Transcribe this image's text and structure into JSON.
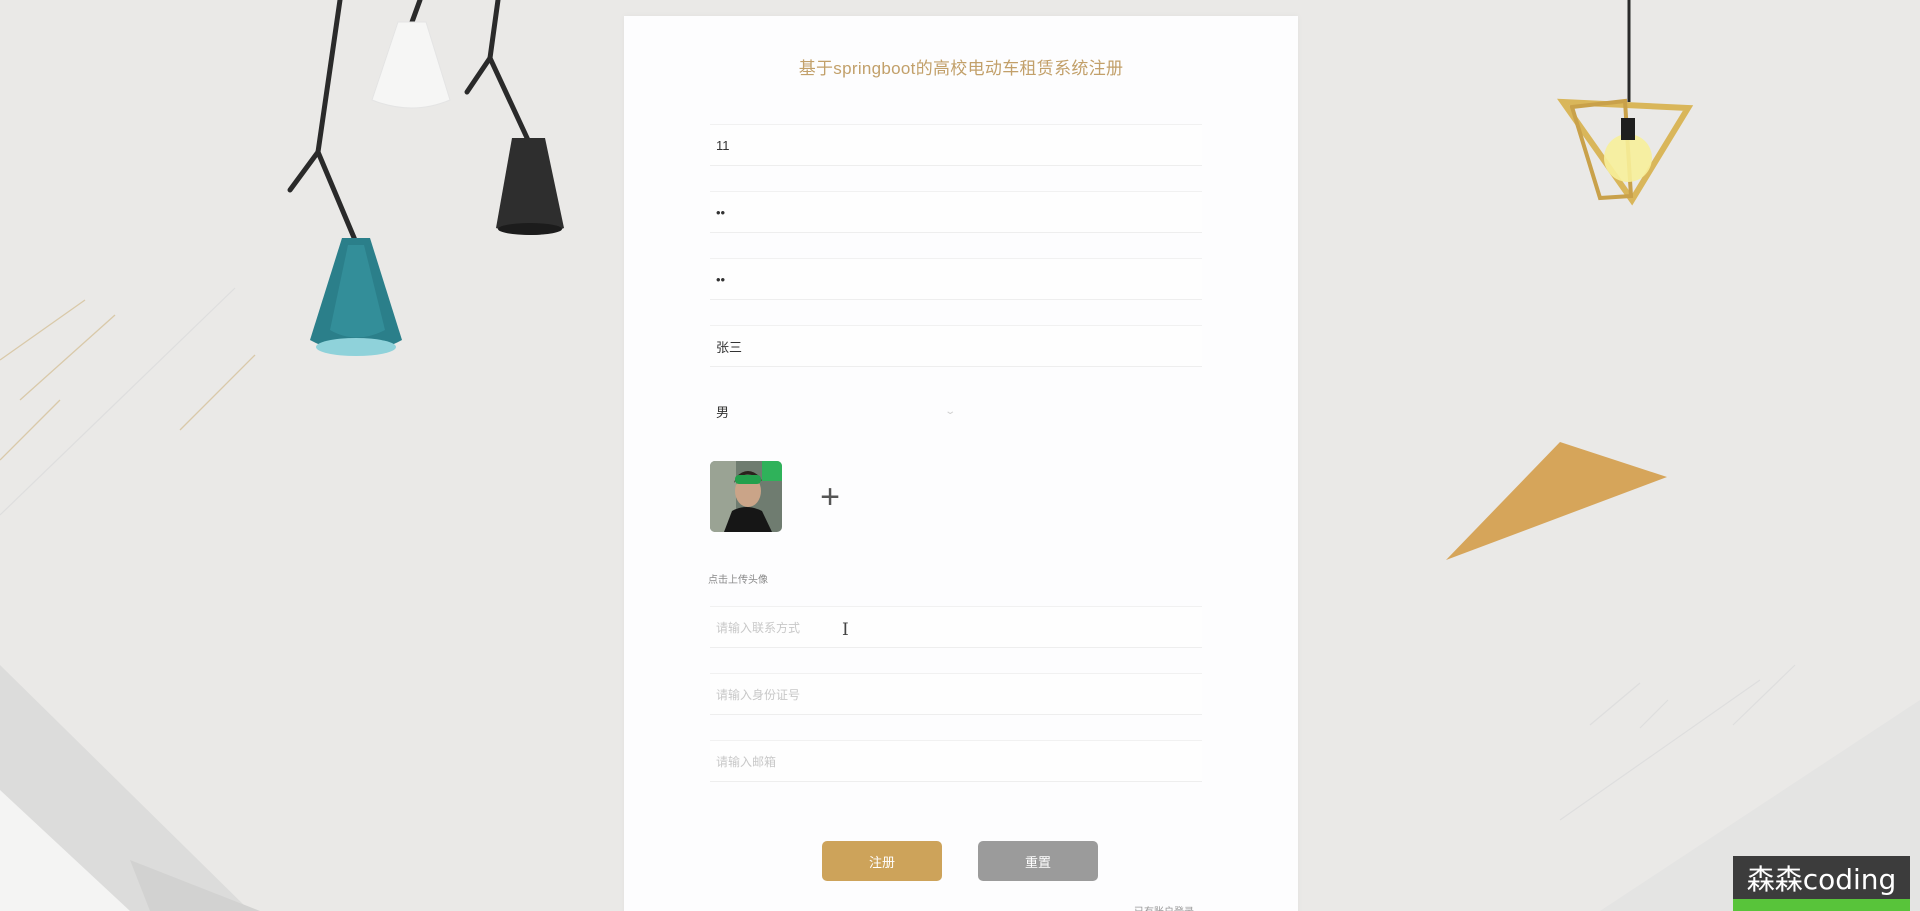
{
  "page": {
    "title": "基于springboot的高校电动车租赁系统注册"
  },
  "form": {
    "account_value": "11",
    "password_value": "••",
    "confirm_password_value": "••",
    "name_value": "张三",
    "gender_selected": "男",
    "upload_hint": "点击上传头像",
    "phone_placeholder": "请输入联系方式",
    "idcard_placeholder": "请输入身份证号",
    "email_placeholder": "请输入邮箱"
  },
  "buttons": {
    "register_label": "注册",
    "reset_label": "重置",
    "login_link": "已有账户登录"
  },
  "watermark": {
    "text": "森森coding"
  },
  "colors": {
    "accent": "#cda35a",
    "title": "#c2a06a",
    "reset_button": "#9b9b9b",
    "background": "#eae9e7"
  }
}
